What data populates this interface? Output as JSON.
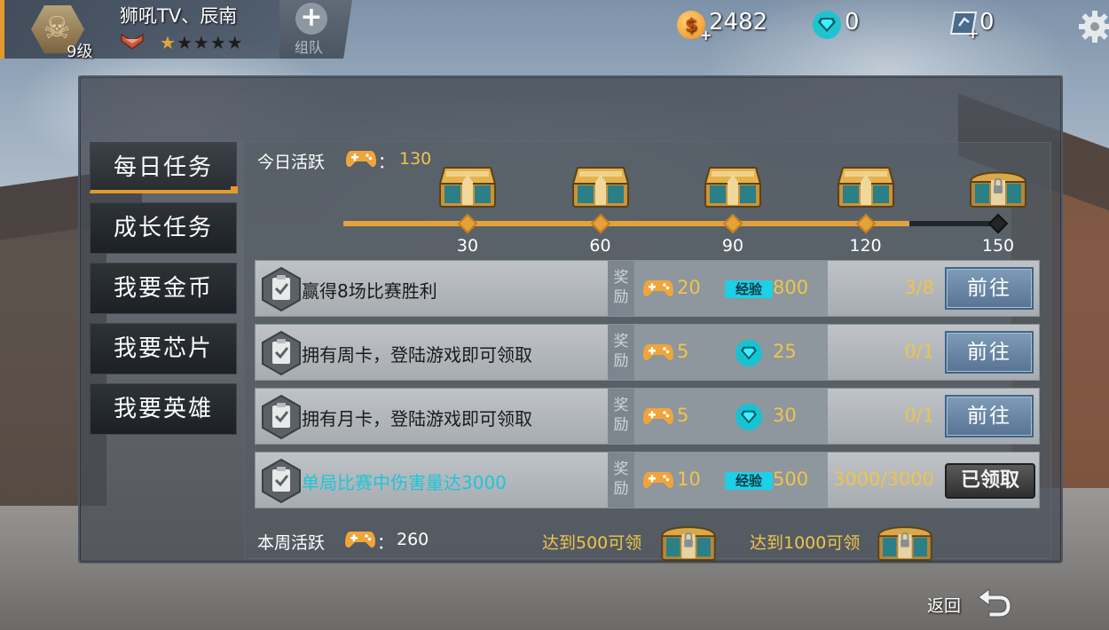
{
  "player": {
    "name": "狮吼TV、辰南",
    "level": "9级",
    "stars_filled": 1,
    "stars_total": 5,
    "star_glyph": "★"
  },
  "team_button": {
    "label": "组队",
    "icon": "plus-icon"
  },
  "currencies": {
    "gold": {
      "value": "2482",
      "icon": "coin-icon"
    },
    "diamond": {
      "value": "0",
      "icon": "diamond-icon"
    },
    "card": {
      "value": "0",
      "icon": "card-icon"
    }
  },
  "sidebar": {
    "items": [
      {
        "label": "每日任务",
        "active": true
      },
      {
        "label": "成长任务",
        "active": false
      },
      {
        "label": "我要金币",
        "active": false
      },
      {
        "label": "我要芯片",
        "active": false
      },
      {
        "label": "我要英雄",
        "active": false
      }
    ]
  },
  "daily_activity": {
    "label": "今日活跃",
    "colon": "：",
    "value": "130",
    "current": 130,
    "max": 150,
    "milestones": [
      {
        "value": "30",
        "amount": 30,
        "chest": "open-chest"
      },
      {
        "value": "60",
        "amount": 60,
        "chest": "open-chest"
      },
      {
        "value": "90",
        "amount": 90,
        "chest": "open-chest"
      },
      {
        "value": "120",
        "amount": 120,
        "chest": "open-chest"
      },
      {
        "value": "150",
        "amount": 150,
        "chest": "locked-chest"
      }
    ]
  },
  "tasks": [
    {
      "name": "赢得8场比赛胜利",
      "reward_label": "奖励",
      "activity": "20",
      "second_type": "exp",
      "exp_label": "经验",
      "second_value": "800",
      "progress": "3/8",
      "action": "前往",
      "completed": false
    },
    {
      "name": "拥有周卡，登陆游戏即可领取",
      "reward_label": "奖励",
      "activity": "5",
      "second_type": "diamond",
      "exp_label": "",
      "second_value": "25",
      "progress": "0/1",
      "action": "前往",
      "completed": false
    },
    {
      "name": "拥有月卡，登陆游戏即可领取",
      "reward_label": "奖励",
      "activity": "5",
      "second_type": "diamond",
      "exp_label": "",
      "second_value": "30",
      "progress": "0/1",
      "action": "前往",
      "completed": false
    },
    {
      "name": "单局比赛中伤害量达3000",
      "reward_label": "奖励",
      "activity": "10",
      "second_type": "exp",
      "exp_label": "经验",
      "second_value": "500",
      "progress": "3000/3000",
      "action": "已领取",
      "completed": true
    }
  ],
  "weekly_activity": {
    "label": "本周活跃",
    "colon": "：",
    "value": "260",
    "goals": [
      {
        "label": "达到500可领",
        "chest": "locked-chest"
      },
      {
        "label": "达到1000可领",
        "chest": "locked-chest"
      }
    ]
  },
  "back_button": {
    "label": "返回",
    "icon": "back-arrow-icon"
  },
  "colors": {
    "accent": "#e6a23a",
    "value_gold": "#f0c44a",
    "exp_cyan": "#1dd0e6",
    "done_text": "#1cc6da",
    "go_button": "#577493"
  }
}
